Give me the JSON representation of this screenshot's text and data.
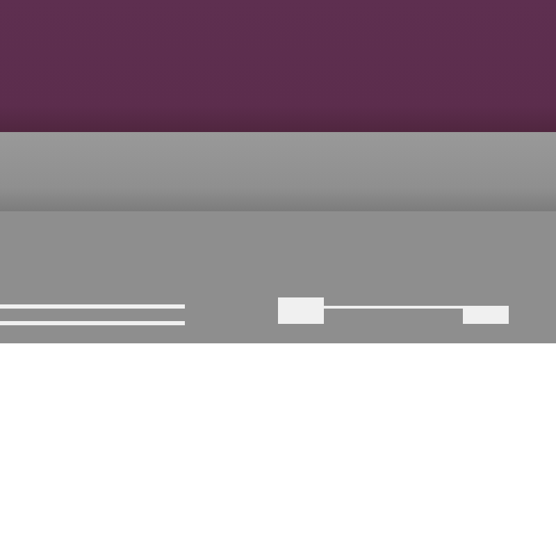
{
  "sections": [
    {
      "kind": "header"
    },
    {
      "kind": "toolbar"
    },
    {
      "kind": "panel"
    }
  ]
}
